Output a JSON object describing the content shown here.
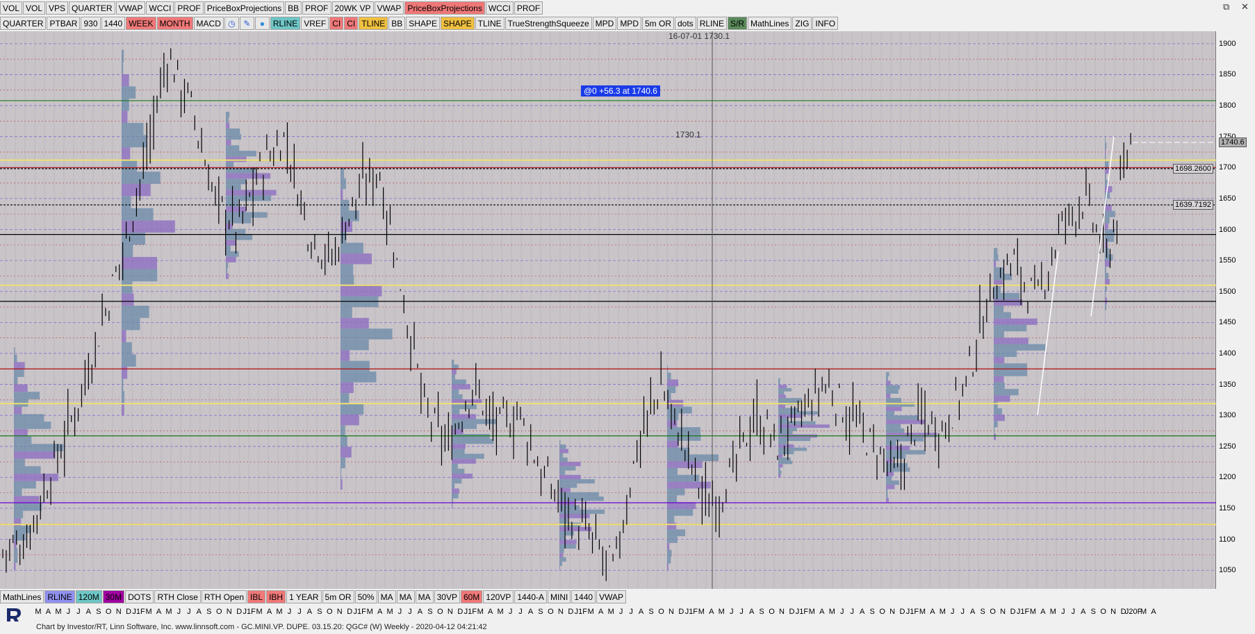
{
  "toolbar_top": [
    "VOL",
    "VOL",
    "VPS",
    "QUARTER",
    "VWAP",
    "WCCI",
    "PROF",
    "PriceBoxProjections",
    "BB",
    "PROF",
    "20WK VP",
    "VWAP",
    "PriceBoxProjections",
    "WCCI",
    "PROF"
  ],
  "toolbar_top_active": {
    "12": "#f07878"
  },
  "toolbar_second": [
    "QUARTER",
    "PTBAR",
    "930",
    "1440",
    "WEEK",
    "MONTH",
    "MACD",
    "",
    "",
    "",
    "RLINE",
    "VREF",
    "CI",
    "CI",
    "TLINE",
    "BB",
    "SHAPE",
    "SHAPE",
    "TLINE",
    "TrueStrengthSqueeze",
    "MPD",
    "MPD",
    "5m OR",
    "dots",
    "RLINE",
    "S/R",
    "MathLines",
    "ZIG",
    "INFO"
  ],
  "toolbar_second_colors": {
    "4": "#f07878",
    "5": "#f07878",
    "10": "#6ec6c6",
    "12": "#f07878",
    "13": "#f07878",
    "14": "#f0c040",
    "17": "#f0c040",
    "25": "#5a8a5a"
  },
  "toolbar_second_icons": {
    "7": "clock-icon",
    "8": "pencil-icon",
    "9": "droplet-icon"
  },
  "toolbar_bottom": [
    "MathLines",
    "RLINE",
    "120M",
    "30M",
    "DOTS",
    "RTH Close",
    "RTH Open",
    "IBL",
    "IBH",
    "1 YEAR",
    "5m OR",
    "50%",
    "MA",
    "MA",
    "MA",
    "30VP",
    "60M",
    "120VP",
    "1440-A",
    "MINI",
    "1440",
    "VWAP"
  ],
  "toolbar_bottom_colors": {
    "1": "#9090f0",
    "2": "#6ec6c6",
    "3": "#a000a0",
    "7": "#f07878",
    "8": "#f07878",
    "16": "#f07878"
  },
  "window_controls": [
    "⧉",
    "✕"
  ],
  "y_axis": {
    "ticks": [
      1900,
      1850,
      1800,
      1750,
      1700,
      1650,
      1600,
      1550,
      1500,
      1450,
      1400,
      1350,
      1300,
      1250,
      1200,
      1150,
      1100,
      1050
    ],
    "min": 1020,
    "max": 1920,
    "last_price_tag": "1740.6",
    "level_tags": [
      "1698.2600",
      "1639.7192"
    ]
  },
  "x_axis": {
    "labels": [
      "M",
      "A",
      "M",
      "J",
      "J",
      "A",
      "S",
      "O",
      "N",
      "D",
      "J1F",
      "M",
      "A",
      "M",
      "J",
      "J",
      "A",
      "S",
      "O",
      "N",
      "D",
      "J1F",
      "M",
      "A",
      "M",
      "J",
      "J",
      "A",
      "S",
      "O",
      "N",
      "D",
      "J1F",
      "M",
      "A",
      "M",
      "J",
      "J",
      "A",
      "S",
      "O",
      "N",
      "D",
      "J1F",
      "M",
      "A",
      "M",
      "J",
      "J",
      "A",
      "S",
      "O",
      "N",
      "D",
      "J1F",
      "M",
      "A",
      "M",
      "J",
      "J",
      "A",
      "S",
      "O",
      "N",
      "D",
      "J1F",
      "M",
      "A",
      "M",
      "J",
      "J",
      "A",
      "S",
      "O",
      "N",
      "D",
      "J1F",
      "M",
      "A",
      "M",
      "J",
      "J",
      "A",
      "S",
      "O",
      "N",
      "D",
      "J1F",
      "M",
      "A",
      "M",
      "J",
      "J",
      "A",
      "S",
      "O",
      "N",
      "D",
      "J1F",
      "M",
      "A",
      "M",
      "J",
      "J",
      "A",
      "S",
      "O",
      "N",
      "D",
      "J20F",
      "M",
      "A"
    ]
  },
  "annotations": {
    "top_label": "16-07-01  1730.1",
    "mid_label": "1730.1",
    "callout": "@0  +56.3 at 1740.6"
  },
  "footer": {
    "copyright": "Chart by Investor/RT, Linn Software, Inc. www.linnsoft.com - GC.MINI.VP. DUPE.   03.15.20: QGC# (W) Weekly - 2020-04-12 04:21:42"
  },
  "chart_data": {
    "type": "candlestick",
    "title": "",
    "instrument": "QGC#",
    "timeframe": "Weekly",
    "ylim": [
      1020,
      1920
    ],
    "y_ticks": [
      1900,
      1850,
      1800,
      1750,
      1700,
      1650,
      1600,
      1550,
      1500,
      1450,
      1400,
      1350,
      1300,
      1250,
      1200,
      1150,
      1100,
      1050
    ],
    "price_path_approx": [
      1080,
      1100,
      1200,
      1300,
      1420,
      1550,
      1700,
      1880,
      1800,
      1650,
      1600,
      1700,
      1750,
      1600,
      1550,
      1650,
      1700,
      1500,
      1300,
      1250,
      1350,
      1280,
      1300,
      1200,
      1150,
      1100,
      1050,
      1250,
      1350,
      1250,
      1150,
      1200,
      1300,
      1250,
      1300,
      1350,
      1300,
      1250,
      1200,
      1300,
      1280,
      1350,
      1500,
      1550,
      1480,
      1600,
      1650,
      1550,
      1740.6
    ],
    "horizontal_levels": [
      {
        "price": 1808,
        "color": "#1a7a1a"
      },
      {
        "price": 1700,
        "color": "#b01010"
      },
      {
        "price": 1698.26,
        "color": "#000000"
      },
      {
        "price": 1639.72,
        "color": "#000000"
      },
      {
        "price": 1592,
        "color": "#000000"
      },
      {
        "price": 1484,
        "color": "#000000"
      },
      {
        "price": 1375,
        "color": "#b01010"
      },
      {
        "price": 1267,
        "color": "#1a7a1a"
      },
      {
        "price": 1159,
        "color": "#6a00d0"
      },
      {
        "price": 1712,
        "color": "#f0e070"
      },
      {
        "price": 1510,
        "color": "#f0e070"
      },
      {
        "price": 1319,
        "color": "#f0e070"
      },
      {
        "price": 1124,
        "color": "#f0e070"
      }
    ],
    "last_price": 1740.6
  }
}
